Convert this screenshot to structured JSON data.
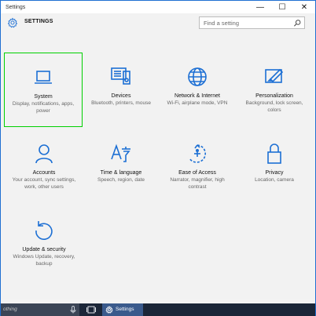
{
  "window": {
    "title": "Settings",
    "minimize": "—",
    "maximize": "☐",
    "close": "✕"
  },
  "header": {
    "label": "SETTINGS",
    "search_placeholder": "Find a setting"
  },
  "tiles": [
    {
      "name": "System",
      "desc": "Display, notifications, apps, power",
      "icon": "laptop-icon",
      "selected": true
    },
    {
      "name": "Devices",
      "desc": "Bluetooth, printers, mouse",
      "icon": "devices-icon"
    },
    {
      "name": "Network & Internet",
      "desc": "Wi-Fi, airplane mode, VPN",
      "icon": "globe-icon"
    },
    {
      "name": "Personalization",
      "desc": "Background, lock screen, colors",
      "icon": "paint-icon"
    },
    {
      "name": "Accounts",
      "desc": "Your account, sync settings, work, other users",
      "icon": "person-icon"
    },
    {
      "name": "Time & language",
      "desc": "Speech, region, date",
      "icon": "language-icon"
    },
    {
      "name": "Ease of Access",
      "desc": "Narrator, magnifier, high contrast",
      "icon": "ease-of-access-icon"
    },
    {
      "name": "Privacy",
      "desc": "Location, camera",
      "icon": "lock-icon"
    },
    {
      "name": "Update & security",
      "desc": "Windows Update, recovery, backup",
      "icon": "update-icon"
    }
  ],
  "taskbar": {
    "search_text": "othing",
    "app_label": "Settings"
  },
  "colors": {
    "accent": "#1c6fd4",
    "selection": "#00d000",
    "taskbar": "#1b2638"
  }
}
